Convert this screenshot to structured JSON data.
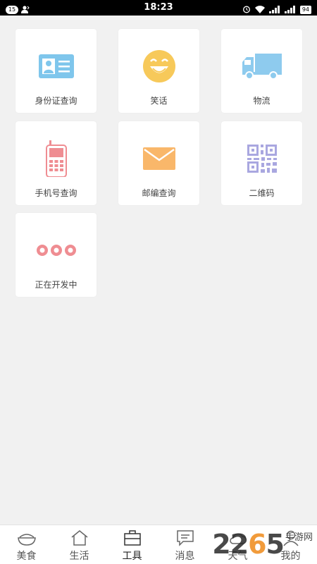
{
  "status_bar": {
    "notification_count": "15",
    "time": "18:23",
    "battery": "94"
  },
  "tools": [
    {
      "label": "身份证查询",
      "icon": "id-card-icon",
      "color": "#7fc6ec"
    },
    {
      "label": "笑话",
      "icon": "smiley-face-icon",
      "color": "#f7c95a"
    },
    {
      "label": "物流",
      "icon": "delivery-truck-icon",
      "color": "#8ecbee"
    },
    {
      "label": "手机号查询",
      "icon": "mobile-phone-icon",
      "color": "#ef8d92"
    },
    {
      "label": "邮编查询",
      "icon": "envelope-icon",
      "color": "#f9b76a"
    },
    {
      "label": "二维码",
      "icon": "qr-code-icon",
      "color": "#a9a7e0"
    },
    {
      "label": "正在开发中",
      "icon": "three-dots-icon",
      "color": "#ef8d92"
    }
  ],
  "tabs": [
    {
      "label": "美食",
      "icon": "rice-bowl-icon"
    },
    {
      "label": "生活",
      "icon": "house-icon"
    },
    {
      "label": "工具",
      "icon": "toolbox-icon",
      "active": true
    },
    {
      "label": "消息",
      "icon": "message-icon"
    },
    {
      "label": "天气",
      "icon": "weather-icon"
    },
    {
      "label": "我的",
      "icon": "person-icon"
    }
  ],
  "watermark": {
    "number": "2265",
    "site": "手游网"
  }
}
